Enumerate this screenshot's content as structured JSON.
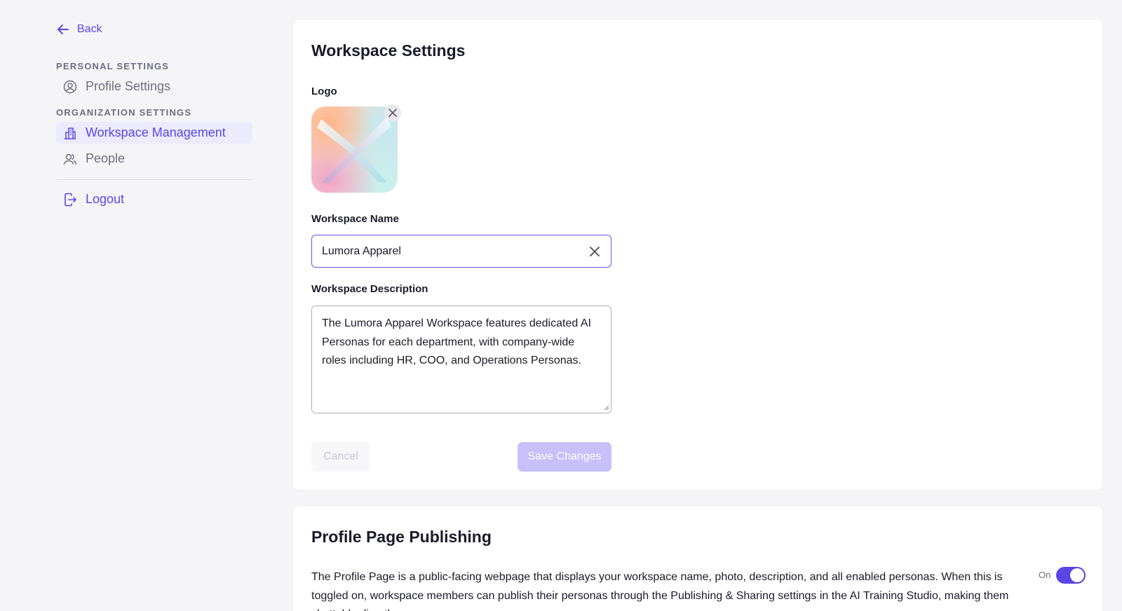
{
  "sidebar": {
    "back_label": "Back",
    "personal_heading": "PERSONAL SETTINGS",
    "organization_heading": "ORGANIZATION SETTINGS",
    "items": [
      {
        "label": "Profile Settings",
        "icon": "user-circle-icon"
      },
      {
        "label": "Workspace Management",
        "icon": "building-icon",
        "active": true
      },
      {
        "label": "People",
        "icon": "users-icon"
      }
    ],
    "logout_label": "Logout"
  },
  "workspace": {
    "title": "Workspace Settings",
    "logo_label": "Logo",
    "name_label": "Workspace Name",
    "name_value": "Lumora Apparel",
    "description_label": "Workspace Description",
    "description_value": "The Lumora Apparel Workspace features dedicated AI Personas for each department, with company-wide roles including HR, COO, and Operations Personas.",
    "cancel_label": "Cancel",
    "save_label": "Save Changes"
  },
  "publishing": {
    "title": "Profile Page Publishing",
    "description": "The Profile Page is a public-facing webpage that displays your workspace name, photo, description, and all enabled personas. When this is toggled on, workspace members can publish their personas through the Publishing & Sharing settings in the AI Training Studio, making them chattable directly",
    "toggle_label": "On",
    "toggle_on": true
  },
  "colors": {
    "accent": "#5b45e6",
    "accent_light": "#ecebfd",
    "background": "#f5f5f8"
  }
}
